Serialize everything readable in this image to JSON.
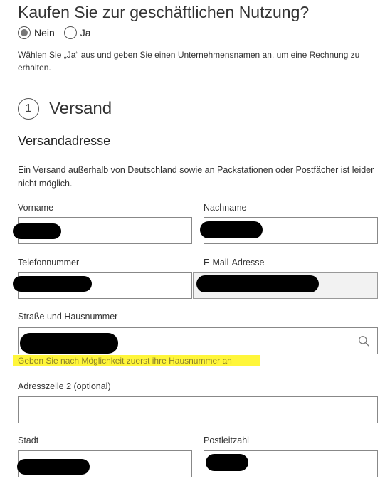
{
  "business": {
    "question": "Kaufen Sie zur geschäftlichen Nutzung?",
    "options": [
      "Nein",
      "Ja"
    ],
    "selected": "Nein",
    "hint": "Wählen Sie „Ja“ aus und geben Sie einen Unternehmensnamen an, um eine Rechnung zu erhalten."
  },
  "step": {
    "number": "1",
    "title": "Versand"
  },
  "shipping": {
    "heading": "Versandadresse",
    "note": "Ein Versand außerhalb von Deutschland sowie an Packstationen oder Postfächer ist leider nicht möglich."
  },
  "fields": {
    "first_name_label": "Vorname",
    "last_name_label": "Nachname",
    "phone_label": "Telefonnummer",
    "email_label": "E-Mail-Adresse",
    "street_label": "Straße und Hausnummer",
    "street_warning": "Geben Sie nach Möglichkeit zuerst ihre Hausnummer an",
    "address2_label": "Adresszeile 2 (optional)",
    "city_label": "Stadt",
    "zip_label": "Postleitzahl"
  },
  "icons": {
    "street_search": "search-icon"
  },
  "colors": {
    "warning_highlight": "#fff63a",
    "redaction": "#000000"
  }
}
